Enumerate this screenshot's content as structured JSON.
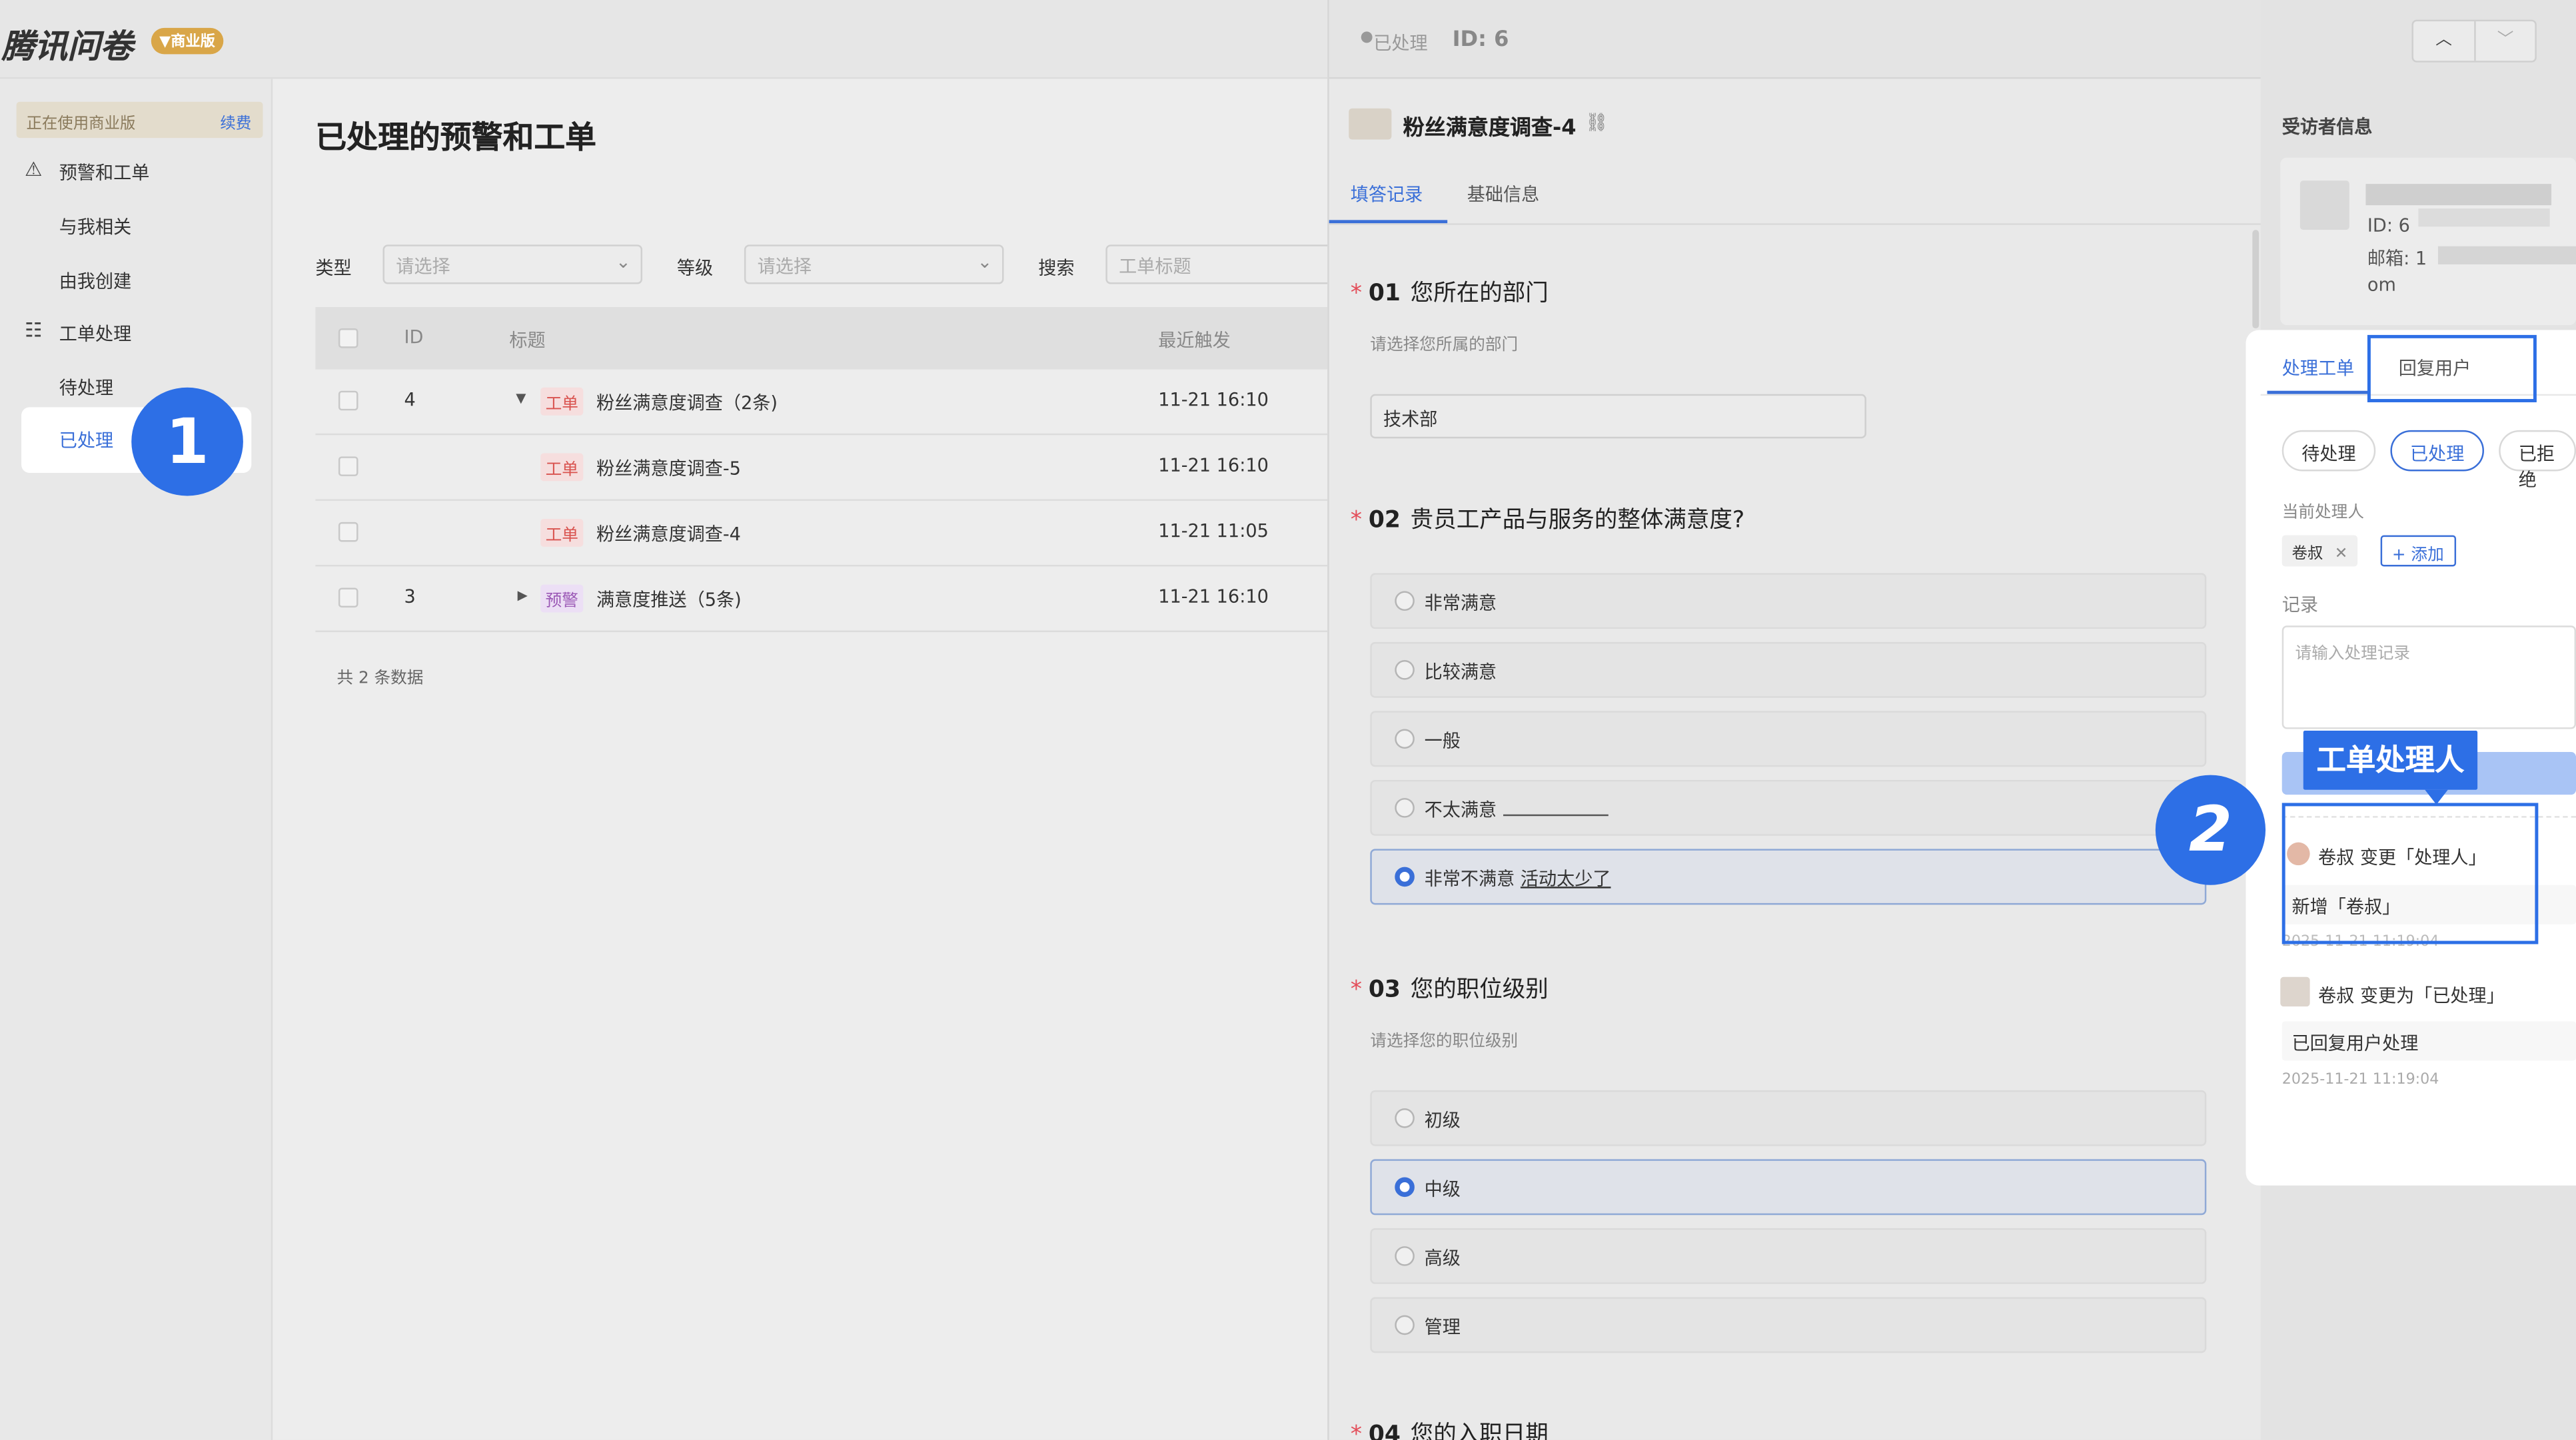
{
  "app": {
    "logo_text": "腾讯问卷",
    "edition_badge": "商业版"
  },
  "sidebar": {
    "business_notice": "正在使用商业版",
    "renew_label": "续费",
    "groups": [
      {
        "label": "预警和工单",
        "items": [
          "与我相关",
          "由我创建"
        ]
      },
      {
        "label": "工单处理",
        "items": [
          "待处理",
          "已处理"
        ]
      }
    ]
  },
  "page": {
    "title": "已处理的预警和工单",
    "filters": {
      "type_label": "类型",
      "type_placeholder": "请选择",
      "level_label": "等级",
      "level_placeholder": "请选择",
      "search_label": "搜索",
      "search_placeholder": "工单标题"
    },
    "table": {
      "headers": {
        "id": "ID",
        "title": "标题",
        "time": "最近触发"
      },
      "rows": [
        {
          "id": "4",
          "tag": "工单",
          "title": "粉丝满意度调查（2条)",
          "time": "11-21 16:10"
        },
        {
          "id": "",
          "tag": "工单",
          "title": "粉丝满意度调查-5",
          "time": "11-21 16:10"
        },
        {
          "id": "",
          "tag": "工单",
          "title": "粉丝满意度调查-4",
          "time": "11-21 11:05"
        },
        {
          "id": "3",
          "tag": "预警",
          "title": "满意度推送（5条)",
          "time": "11-21 16:10"
        }
      ],
      "footer": "共 2 条数据"
    }
  },
  "detail": {
    "status": "已处理",
    "id_text": "ID: 6",
    "survey_title": "粉丝满意度调查-4",
    "tabs": [
      "填答记录",
      "基础信息"
    ],
    "questions": [
      {
        "num": "01",
        "title": "您所在的部门",
        "hint": "请选择您所属的部门",
        "answer": "技术部"
      },
      {
        "num": "02",
        "title": "贵员工产品与服务的整体满意度?",
        "options": [
          "非常满意",
          "比较满意",
          "一般",
          "不太满意",
          "非常不满意"
        ],
        "other_text": "活动太少了"
      },
      {
        "num": "03",
        "title": "您的职位级别",
        "hint": "请选择您的职位级别",
        "options": [
          "初级",
          "中级",
          "高级",
          "管理"
        ]
      },
      {
        "num": "04",
        "title": "您的入职日期"
      }
    ]
  },
  "respondent": {
    "section_title": "受访者信息",
    "id_label": "ID: 6",
    "email_label": "邮箱: 1",
    "email_tail": "om"
  },
  "panel": {
    "tabs": [
      "处理工单",
      "回复用户"
    ],
    "status_pills": [
      "待处理",
      "已处理",
      "已拒绝"
    ],
    "handler_label": "当前处理人",
    "handler_name": "卷叔",
    "add_button": "+ 添加",
    "record_label": "记录",
    "record_placeholder": "请输入处理记录",
    "log": [
      {
        "text": "卷叔 变更「处理人」",
        "detail": "新增「卷叔」",
        "time": "2025-11-21 11:19:04"
      },
      {
        "text": "卷叔 变更为「已处理」",
        "detail": "已回复用户处理",
        "time": "2025-11-21 11:19:04"
      }
    ]
  },
  "annotations": {
    "step1": "1",
    "step2": "2",
    "callout": "工单处理人"
  }
}
